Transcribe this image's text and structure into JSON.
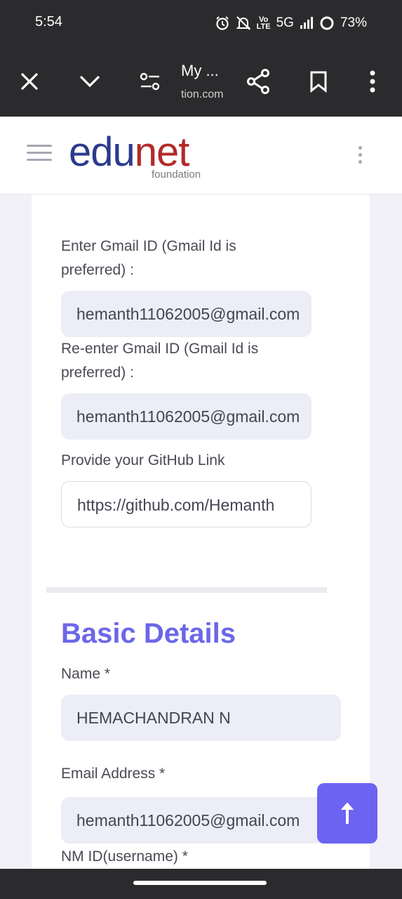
{
  "status_bar": {
    "time": "5:54",
    "network": "5G",
    "volte": "Vo LTE",
    "battery": "73%"
  },
  "browser": {
    "title": "My ...",
    "url": "tion.com"
  },
  "site": {
    "logo_part1": "edu",
    "logo_part2": "net",
    "logo_sub": "foundation"
  },
  "form": {
    "gmail_label": "Enter Gmail ID (Gmail Id is preferred) :",
    "gmail_value": "hemanth11062005@gmail.com",
    "regmail_label": "Re-enter Gmail ID (Gmail Id is preferred) :",
    "regmail_value": "hemanth11062005@gmail.com",
    "github_label": "Provide your GitHub Link",
    "github_value": "https://github.com/Hemanth",
    "section_title": "Basic Details",
    "name_label": "Name *",
    "name_value": "HEMACHANDRAN N",
    "email_label": "Email Address *",
    "email_value": "hemanth11062005@gmail.com",
    "nmid_label": "NM ID(username) *"
  },
  "colors": {
    "accent": "#6b67e8",
    "logo_blue": "#2b3a8c",
    "logo_red": "#b22a2a"
  }
}
